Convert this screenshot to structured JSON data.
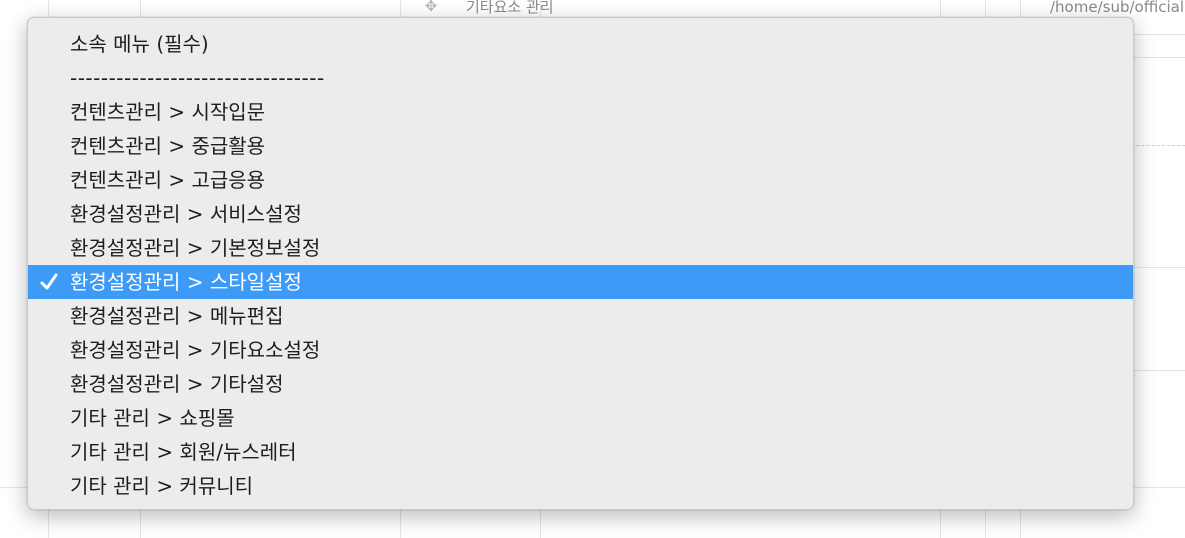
{
  "background": {
    "menu_name": "기타요소 관리",
    "url_path": "/home/sub/official"
  },
  "dropdown": {
    "selected_index": 7,
    "options": [
      {
        "label": "소속 메뉴 (필수)"
      },
      {
        "label": "---------------------------------"
      },
      {
        "label": "컨텐츠관리 > 시작입문"
      },
      {
        "label": "컨텐츠관리 > 중급활용"
      },
      {
        "label": "컨텐츠관리 > 고급응용"
      },
      {
        "label": "환경설정관리 > 서비스설정"
      },
      {
        "label": "환경설정관리 > 기본정보설정"
      },
      {
        "label": "환경설정관리 > 스타일설정"
      },
      {
        "label": "환경설정관리 > 메뉴편집"
      },
      {
        "label": "환경설정관리 > 기타요소설정"
      },
      {
        "label": "환경설정관리 > 기타설정"
      },
      {
        "label": "기타 관리 > 쇼핑몰"
      },
      {
        "label": "기타 관리 > 회원/뉴스레터"
      },
      {
        "label": "기타 관리 > 커뮤니티"
      }
    ],
    "checkmark_icon": "checkmark-icon",
    "highlight_color": "#3d9bf7"
  }
}
